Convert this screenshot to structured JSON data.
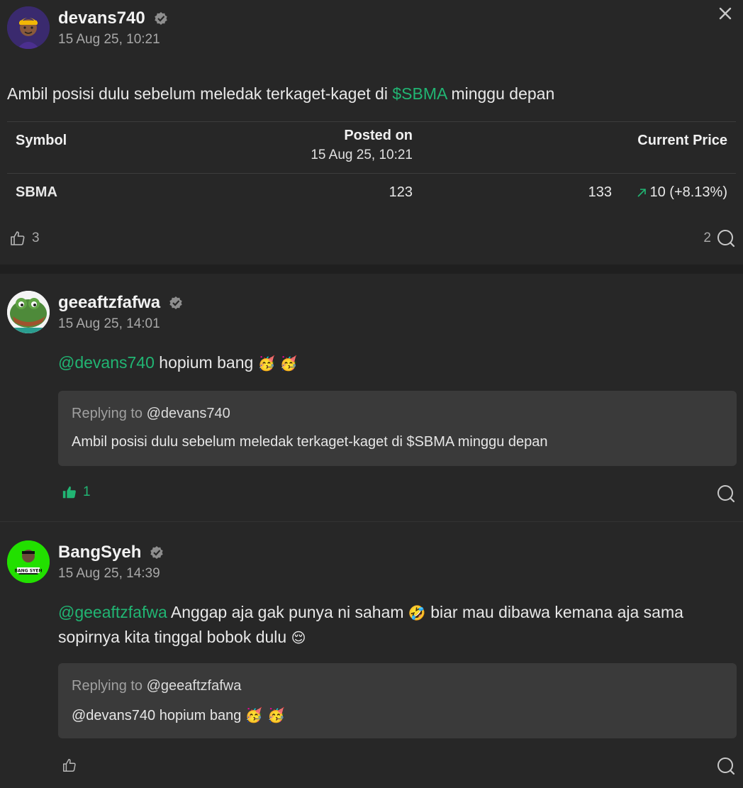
{
  "post": {
    "author": "devans740",
    "timestamp": "15 Aug 25, 10:21",
    "text_before": "Ambil posisi dulu sebelum meledak terkaget-kaget di ",
    "ticker": "$SBMA",
    "text_after": " minggu depan",
    "table": {
      "headers": {
        "symbol": "Symbol",
        "posted_on": "Posted on",
        "posted_on_date": "15 Aug 25, 10:21",
        "current_price": "Current Price"
      },
      "row": {
        "symbol": "SBMA",
        "posted_price": "123",
        "current_price": "133",
        "change": "10 (+8.13%)"
      }
    },
    "likes": "3",
    "comments": "2"
  },
  "comments": [
    {
      "author": "geeaftzfafwa",
      "timestamp": "15 Aug 25, 14:01",
      "mention": "@devans740",
      "text": " hopium bang ",
      "emojis": "🥳 🥳",
      "reply_label": "Replying to ",
      "reply_to": "@devans740",
      "reply_text": "Ambil posisi dulu sebelum meledak terkaget-kaget di $SBMA minggu depan",
      "likes": "1"
    },
    {
      "author": "BangSyeh",
      "timestamp": "15 Aug 25, 14:39",
      "mention": "@geeaftzfafwa",
      "text_line1": " Anggap aja gak punya ni saham ",
      "emoji1": "🤣",
      "text_line1b": " biar mau dibawa kemana aja sama",
      "text_line2": "sopirnya kita tinggal bobok dulu ",
      "emoji2": "😌",
      "reply_label": "Replying to ",
      "reply_to": "@geeaftzfafwa",
      "reply_text": "@devans740 hopium bang ",
      "reply_emojis": "🥳 🥳",
      "avatar_text": "BANG SYEH"
    }
  ],
  "colors": {
    "accent": "#21b573",
    "background": "#272727",
    "reply_box": "#3a3a3a"
  },
  "icons": {
    "close": "close-icon",
    "like": "thumbs-up-icon",
    "comment": "comment-icon",
    "verified": "verified-icon",
    "trend": "arrow-up-right-icon"
  }
}
